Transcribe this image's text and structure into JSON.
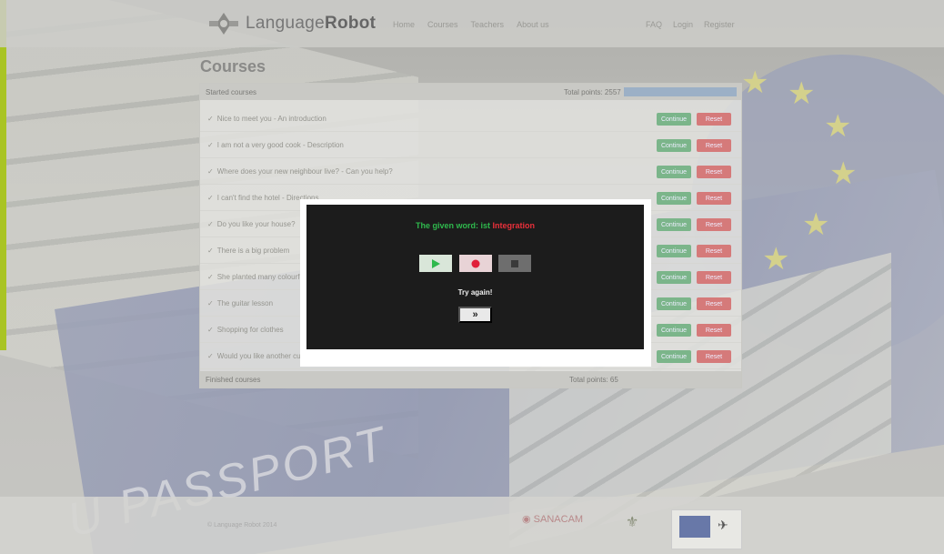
{
  "header": {
    "logo_light": "Language",
    "logo_bold": "Robot",
    "nav": [
      "Home",
      "Courses",
      "Teachers",
      "About us"
    ],
    "nav_right": [
      "FAQ",
      "Login",
      "Register"
    ]
  },
  "page": {
    "title": "Courses"
  },
  "panel": {
    "header_left": "Started courses",
    "header_right": "Total points: 2557",
    "progress": 1.0,
    "rows": [
      "Nice to meet you - An introduction",
      "I am not a very good cook - Description",
      "Where does your new neighbour live? - Can you help?",
      "I can't find the hotel - Directions",
      "Do you like your house?",
      "There is a big problem",
      "She planted many colourful flowers",
      "The guitar lesson",
      "Shopping for clothes",
      "Would you like another cup?"
    ],
    "btn_continue": "Continue",
    "btn_reset": "Reset",
    "footer_left": "Finished courses",
    "footer_right": "Total points: 65"
  },
  "modal": {
    "msg_prefix": "The given word: ist",
    "msg_wrong": "Integration",
    "try_again": "Try again!",
    "next_symbol": "»"
  },
  "footer": {
    "copyright": "© Language Robot 2014",
    "partner_1": "SANACAM"
  },
  "colors": {
    "accent_green": "#2fb94d",
    "accent_red": "#e8303a",
    "modal_bg": "#1c1c1c"
  }
}
